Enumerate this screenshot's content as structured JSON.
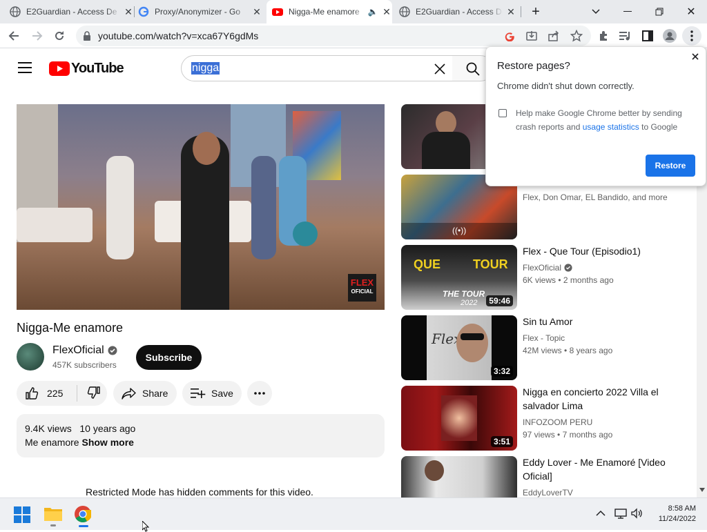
{
  "tabs": [
    {
      "title": "E2Guardian - Access De",
      "icon": "globe-icon"
    },
    {
      "title": "Proxy/Anonymizer - Go",
      "icon": "google-icon"
    },
    {
      "title": "Nigga-Me enamore",
      "icon": "youtube-icon"
    },
    {
      "title": "E2Guardian - Access De",
      "icon": "globe-icon"
    }
  ],
  "address_bar": {
    "url": "youtube.com/watch?v=xca67Y6gdMs"
  },
  "youtube": {
    "logo_text": "YouTube",
    "search_value": "nigga"
  },
  "video": {
    "title": "Nigga-Me enamore",
    "watermark_top": "FLEX",
    "watermark_bottom": "OFICIAL",
    "channel": "FlexOficial",
    "subscribers": "457K subscribers",
    "subscribe_label": "Subscribe",
    "likes": "225",
    "share_label": "Share",
    "save_label": "Save",
    "views": "9.4K views",
    "age": "10 years ago",
    "description": "Me enamore",
    "show_more": "Show more",
    "comments_notice": "Restricted Mode has hidden comments for this video."
  },
  "related": [
    {
      "title": "",
      "channel": "",
      "meta": "",
      "duration": ""
    },
    {
      "title": "",
      "channel": "Flex, Don Omar, EL Bandido, and more",
      "meta": "",
      "duration": "",
      "live_icon": "broadcast-icon"
    },
    {
      "title": "Flex - Que Tour (Episodio1)",
      "channel": "FlexOficial",
      "views": "6K views",
      "age": "2 months ago",
      "duration": "59:46",
      "thumb_text_1": "QUE",
      "thumb_text_2": "TOUR",
      "thumb_text_3": "THE TOUR",
      "thumb_text_4": "2022"
    },
    {
      "title": "Sin tu Amor",
      "channel": "Flex - Topic",
      "views": "42M views",
      "age": "8 years ago",
      "duration": "3:32",
      "thumb_text_1": "Flex"
    },
    {
      "title": "Nigga en concierto 2022 Villa el salvador Lima",
      "channel": "INFOZOOM PERU",
      "views": "97 views",
      "age": "7 months ago",
      "duration": "3:51"
    },
    {
      "title": "Eddy Lover - Me Enamoré [Video Oficial]",
      "channel": "EddyLoverTV",
      "views": "",
      "age": "",
      "duration": ""
    }
  ],
  "restore_popup": {
    "title": "Restore pages?",
    "message": "Chrome didn't shut down correctly.",
    "checkbox_text_1": "Help make Google Chrome better by sending crash reports and",
    "checkbox_link": "usage statistics",
    "checkbox_text_2": "to Google",
    "restore_label": "Restore"
  },
  "taskbar": {
    "time": "8:58 AM",
    "date": "11/24/2022"
  },
  "colors": {
    "youtube_red": "#ff0000",
    "chrome_blue": "#1a73e8",
    "link_blue": "#1a0dab"
  }
}
